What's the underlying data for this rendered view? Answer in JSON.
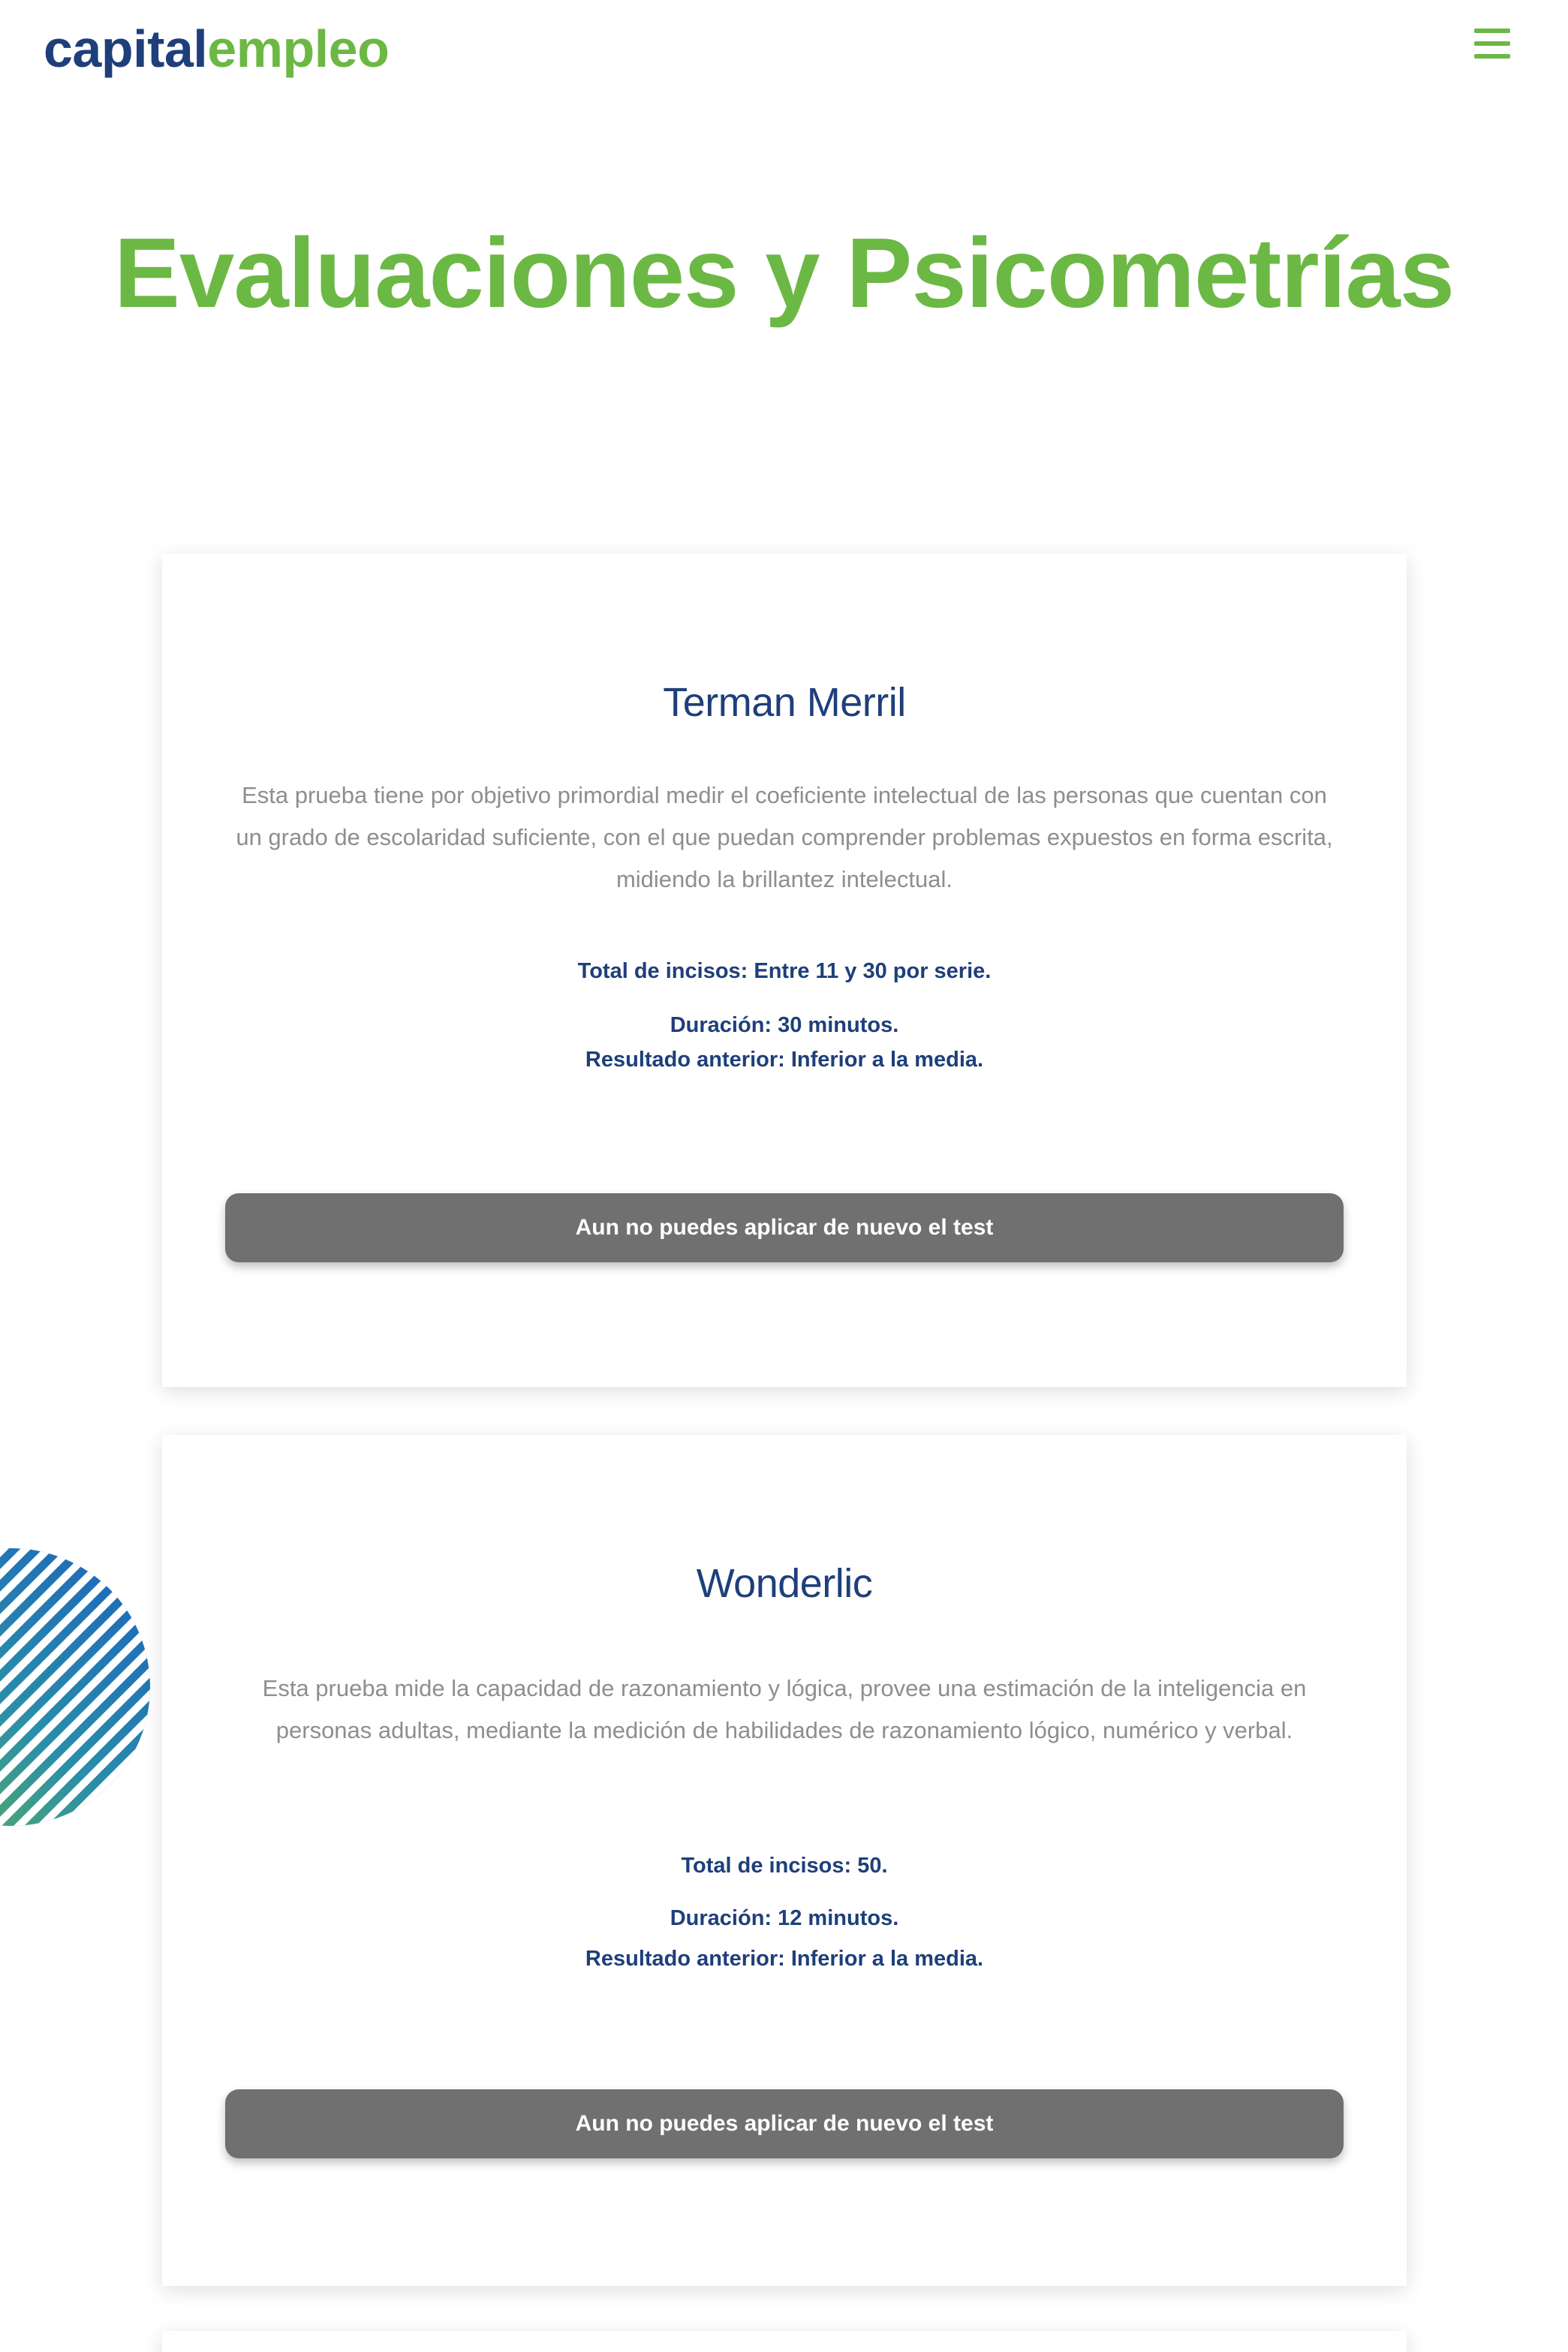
{
  "header": {
    "logo_part_a": "capital",
    "logo_part_b": "empleo",
    "menu_icon": "hamburger-menu-icon"
  },
  "page": {
    "title": "Evaluaciones y Psicometrías"
  },
  "colors": {
    "brand_blue": "#1e3f7a",
    "brand_green": "#6cb844",
    "button_disabled": "#707070",
    "description_gray": "#8e8e8e"
  },
  "tests": [
    {
      "name": "Terman Merril",
      "description": "Esta prueba tiene por objetivo primordial medir el coeficiente intelectual de las personas que cuentan con un grado de escolaridad suficiente, con el que puedan comprender problemas expuestos en forma escrita, midiendo la brillantez intelectual.",
      "total_items": "Total de incisos: Entre 11 y 30 por serie.",
      "duration": "Duración: 30 minutos.",
      "previous_result": "Resultado anterior: Inferior a la media.",
      "button_label": "Aun no puedes aplicar de nuevo el test"
    },
    {
      "name": "Wonderlic",
      "description": "Esta prueba mide la capacidad de razonamiento y lógica, provee una estimación de la inteligencia en personas adultas, mediante la medición de habilidades de razonamiento lógico, numérico y verbal.",
      "total_items": "Total de incisos: 50.",
      "duration": "Duración: 12 minutos.",
      "previous_result": "Resultado anterior: Inferior a la media.",
      "button_label": "Aun no puedes aplicar de nuevo el test"
    }
  ]
}
